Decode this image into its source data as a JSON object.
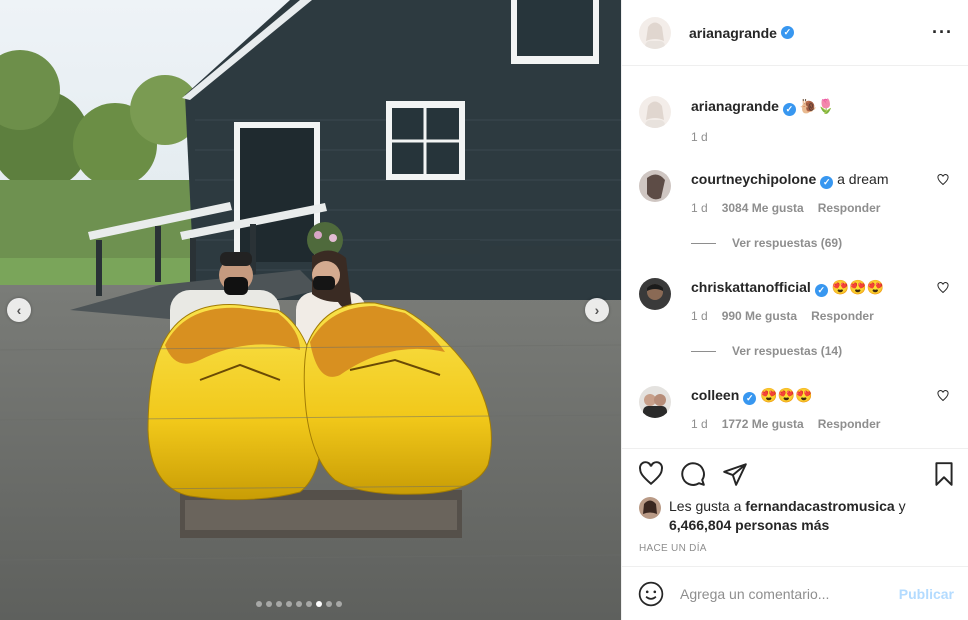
{
  "post": {
    "author": "arianagrande",
    "more_icon": "more-horizontal-icon",
    "caption": {
      "username": "arianagrande",
      "text": "🐌🌷",
      "time": "1 d"
    },
    "slide_count": 9,
    "active_slide": 6
  },
  "comments": [
    {
      "username": "courtneychipolone",
      "verified": true,
      "text": "a dream",
      "time": "1 d",
      "likes": "3084 Me gusta",
      "reply": "Responder",
      "replies": "Ver respuestas (69)"
    },
    {
      "username": "chriskattanofficial",
      "verified": true,
      "text": "😍😍😍",
      "time": "1 d",
      "likes": "990 Me gusta",
      "reply": "Responder",
      "replies": "Ver respuestas (14)"
    },
    {
      "username": "colleen",
      "verified": true,
      "text": "😍😍😍",
      "time": "1 d",
      "likes": "1772 Me gusta",
      "reply": "Responder",
      "replies": ""
    }
  ],
  "likes": {
    "prefix": "Les gusta a",
    "user": "fernandacastromusica",
    "conj": "y",
    "others": "6,466,804 personas más"
  },
  "time_ago": "HACE UN DÍA",
  "add_comment": {
    "placeholder": "Agrega un comentario...",
    "publish": "Publicar"
  },
  "colors": {
    "verified": "#3897f0",
    "publish": "#b3dbff",
    "muted": "#8e8e8e"
  }
}
